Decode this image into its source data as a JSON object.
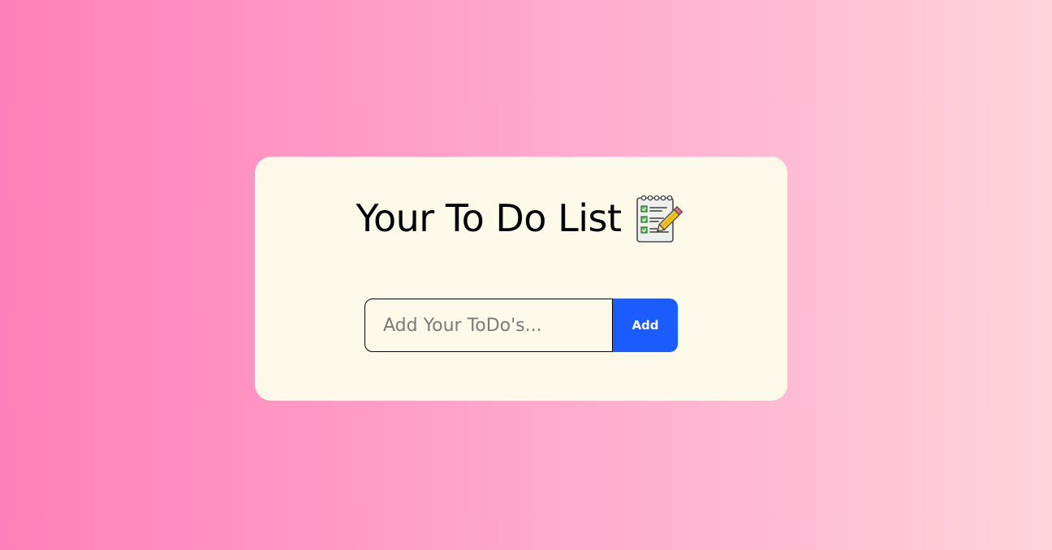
{
  "page": {
    "background_colors": [
      "#ff80b8",
      "#ffd4dc"
    ]
  },
  "card": {
    "background_color": "#fdf9e9",
    "title": "Your To Do List",
    "title_icon": "memo-checklist-pencil-icon"
  },
  "todo_form": {
    "input_value": "",
    "input_placeholder": "Add Your ToDo's...",
    "add_label": "Add",
    "add_button_color": "#1a5cff"
  }
}
